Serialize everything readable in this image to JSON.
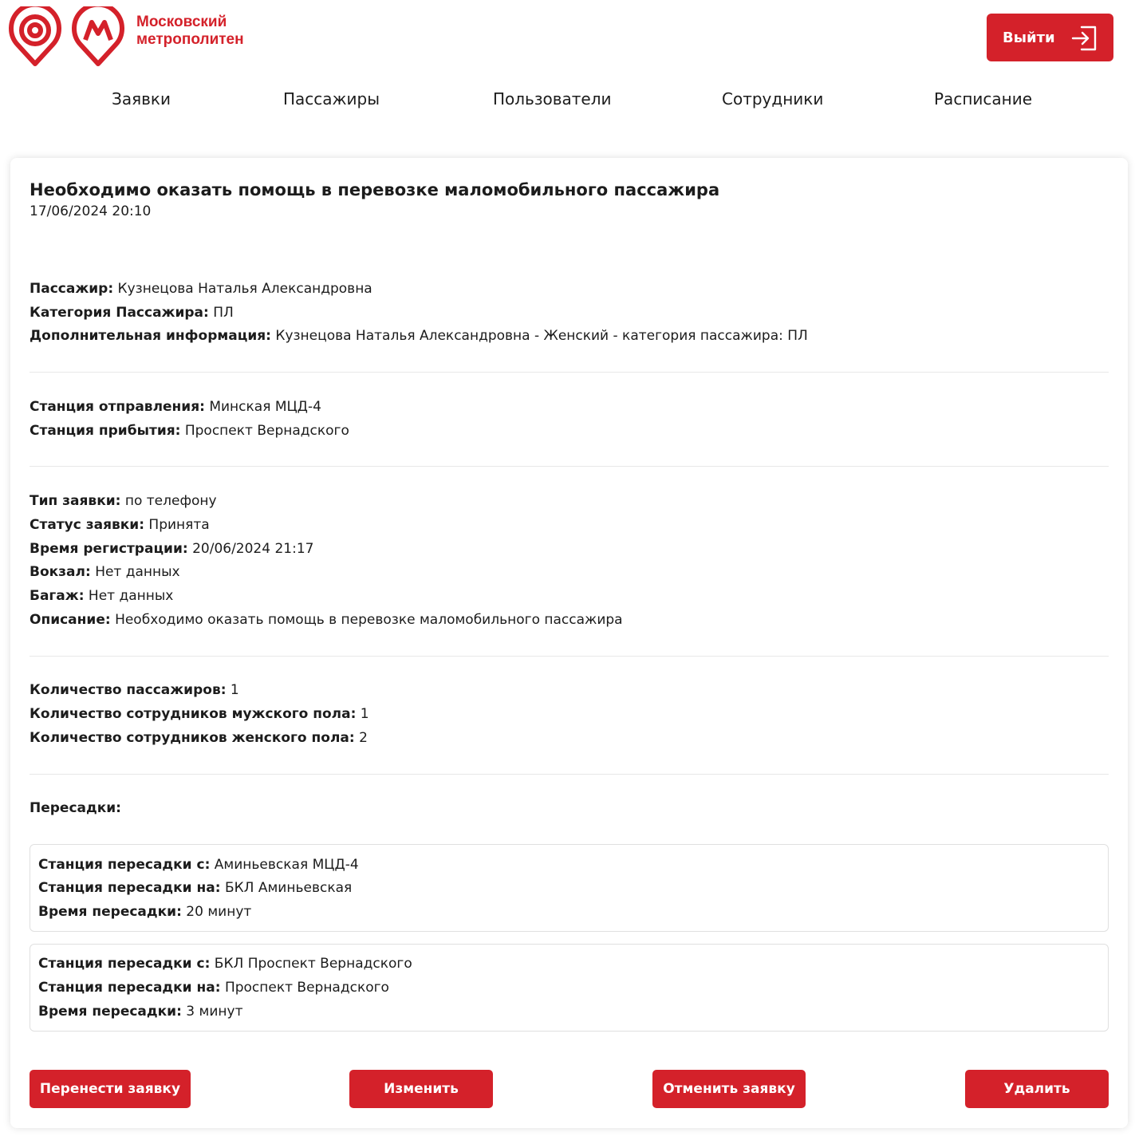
{
  "brand": {
    "line1": "Московский",
    "line2": "метрополитен",
    "color": "#d4212a"
  },
  "header": {
    "logout_label": "Выйти",
    "logout_icon": "logout-arrow-icon"
  },
  "nav": {
    "items": [
      {
        "label": "Заявки"
      },
      {
        "label": "Пассажиры"
      },
      {
        "label": "Пользователи"
      },
      {
        "label": "Сотрудники"
      },
      {
        "label": "Расписание"
      }
    ]
  },
  "request": {
    "title": "Необходимо оказать помощь в перевозке маломобильного пассажира",
    "date": "17/06/2024 20:10",
    "passenger": {
      "name_label": "Пассажир:",
      "name_value": "Кузнецова Наталья Александровна",
      "category_label": "Категория Пассажира:",
      "category_value": "ПЛ",
      "info_label": "Дополнительная информация:",
      "info_value": "Кузнецова Наталья Александровна - Женский - категория пассажира: ПЛ"
    },
    "stations": {
      "departure_label": "Станция отправления:",
      "departure_value": "Минская МЦД-4",
      "arrival_label": "Станция прибытия:",
      "arrival_value": "Проспект Вернадского"
    },
    "details": {
      "type_label": "Тип заявки:",
      "type_value": "по телефону",
      "status_label": "Статус заявки:",
      "status_value": "Принята",
      "reg_label": "Время регистрации:",
      "reg_value": "20/06/2024 21:17",
      "station_label": "Вокзал:",
      "station_value": "Нет данных",
      "baggage_label": "Багаж:",
      "baggage_value": "Нет данных",
      "desc_label": "Описание:",
      "desc_value": "Необходимо оказать помощь в перевозке маломобильного пассажира"
    },
    "counts": {
      "passengers_label": "Количество пассажиров:",
      "passengers_value": "1",
      "male_label": "Количество сотрудников мужского пола:",
      "male_value": "1",
      "female_label": "Количество сотрудников женского пола:",
      "female_value": "2"
    },
    "transfers_label": "Пересадки:",
    "transfers": [
      {
        "from_label": "Станция пересадки с:",
        "from_value": "Аминьевская МЦД-4",
        "to_label": "Станция пересадки на:",
        "to_value": "БКЛ Аминьевская",
        "time_label": "Время пересадки:",
        "time_value": "20 минут"
      },
      {
        "from_label": "Станция пересадки с:",
        "from_value": "БКЛ Проспект Вернадского",
        "to_label": "Станция пересадки на:",
        "to_value": "Проспект Вернадского",
        "time_label": "Время пересадки:",
        "time_value": "3 минут"
      }
    ]
  },
  "actions": {
    "move_label": "Перенести заявку",
    "edit_label": "Изменить",
    "cancel_label": "Отменить заявку",
    "delete_label": "Удалить"
  }
}
